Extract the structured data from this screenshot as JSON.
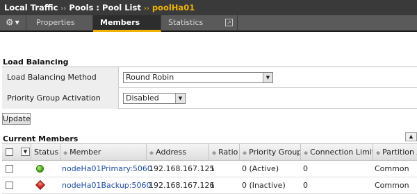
{
  "breadcrumb": {
    "items": [
      "Local Traffic",
      "Pools : Pool List"
    ],
    "current": "poolHa01",
    "separator": "››"
  },
  "tabs": {
    "gear_icon": "gear-icon",
    "properties": "Properties",
    "members": "Members",
    "statistics": "Statistics",
    "statistics_icon": "external-link-icon",
    "active": "Members"
  },
  "load_balancing": {
    "title": "Load Balancing",
    "method_label": "Load Balancing Method",
    "method_value": "Round Robin",
    "priority_label": "Priority Group Activation",
    "priority_value": "Disabled",
    "update_button": "Update"
  },
  "current_members": {
    "title": "Current Members",
    "columns": [
      "Status",
      "Member",
      "Address",
      "Ratio",
      "Priority Group",
      "Connection Limit",
      "Partition /"
    ],
    "rows": [
      {
        "status": "green-circle",
        "member": "nodeHa01Primary:5060",
        "address": "192.168.167.125",
        "ratio": "1",
        "priority_group": "0 (Active)",
        "connection_limit": "0",
        "partition": "Common"
      },
      {
        "status": "red-diamond",
        "member": "nodeHa01Backup:5060",
        "address": "192.168.167.126",
        "ratio": "1",
        "priority_group": "0 (Inactive)",
        "connection_limit": "0",
        "partition": "Common"
      }
    ]
  },
  "colors": {
    "accent": "#f0b400",
    "link": "#1d48a6",
    "topbar": "#3a3a3a",
    "tabbar": "#5a5a5a"
  }
}
